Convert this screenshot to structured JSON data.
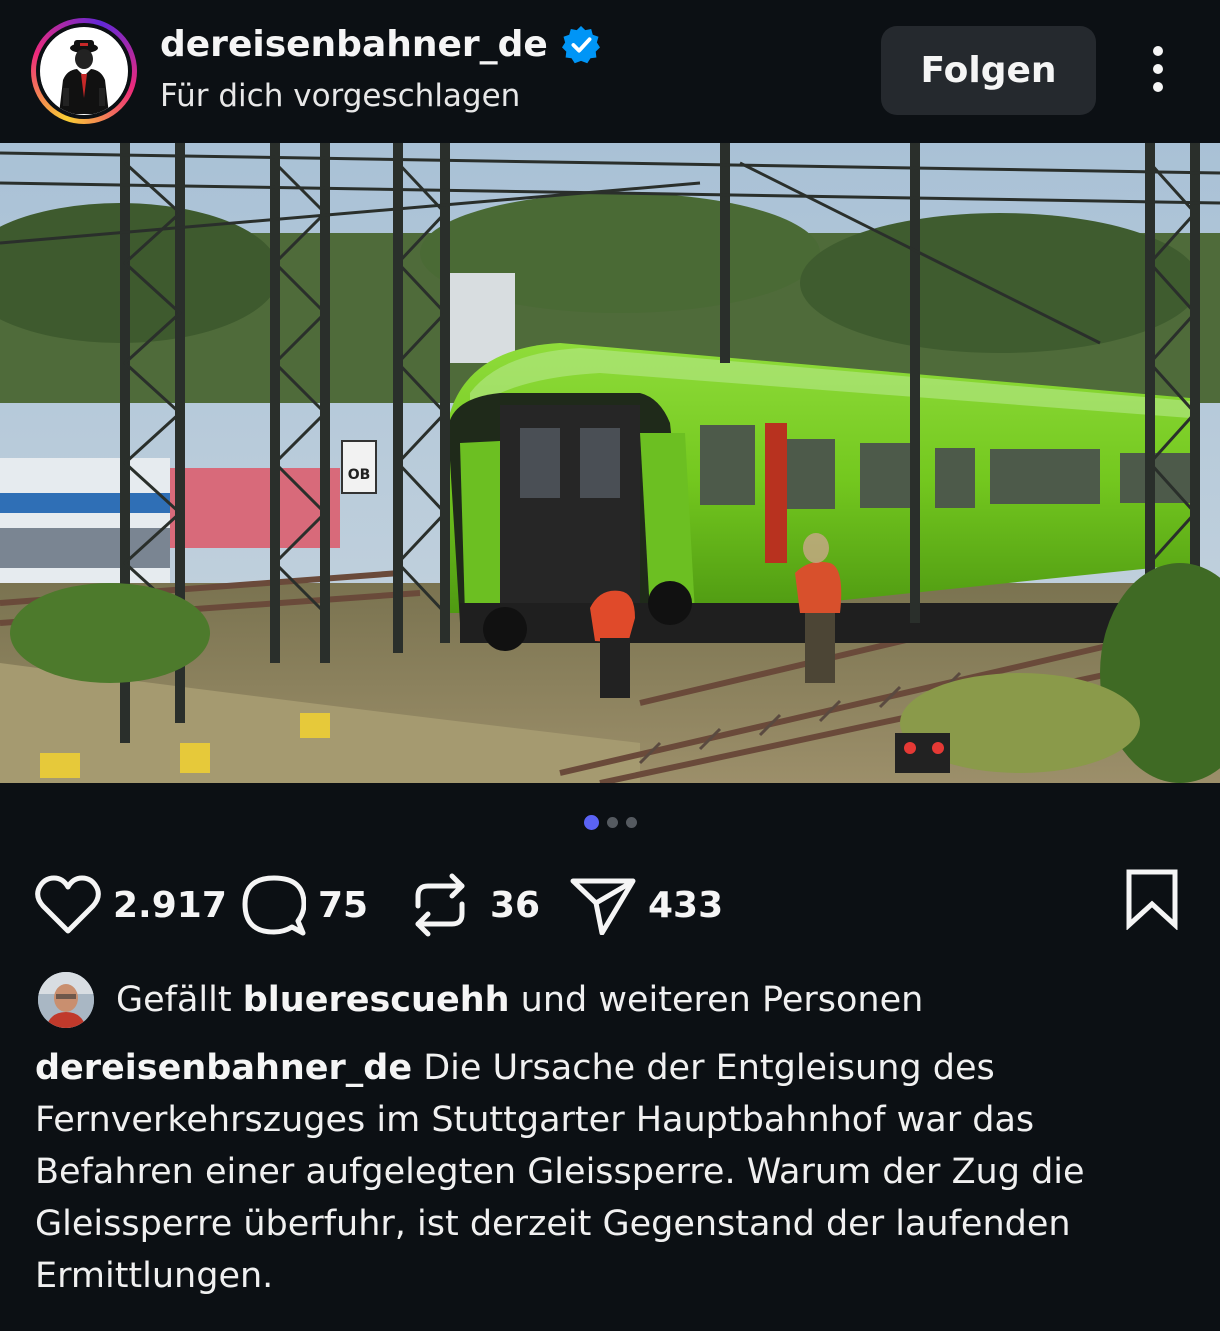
{
  "post": {
    "username": "dereisenbahner_de",
    "subtitle": "Für dich vorgeschlagen",
    "follow_label": "Folgen",
    "verified": true
  },
  "carousel": {
    "pages": 3,
    "active_index": 0
  },
  "actions": {
    "likes_count": "2.917",
    "comments_count": "75",
    "reposts_count": "36",
    "shares_count": "433"
  },
  "likes_line": {
    "prefix": "Gefällt",
    "user": "bluerescuehh",
    "suffix": "und weiteren Personen"
  },
  "caption": {
    "username": "dereisenbahner_de",
    "text": "Die Ursache der Entgleisung des Fernverkehrszuges im Stuttgarter Hauptbahnhof war das Befahren einer aufgelegten Gleissperre. Warum der Zug die Gleissperre überfuhr, ist derzeit Gegenstand der laufenden Ermittlungen."
  },
  "photo_sign": "OB",
  "colors": {
    "background": "#0c1014",
    "verified_blue": "#0095f6",
    "dot_active": "#5b63f5",
    "train_green": "#7ed321",
    "follow_button": "#25292e"
  },
  "icons": [
    "verified-badge-icon",
    "more-options-icon",
    "heart-icon",
    "comment-icon",
    "repost-icon",
    "share-icon",
    "bookmark-icon"
  ]
}
